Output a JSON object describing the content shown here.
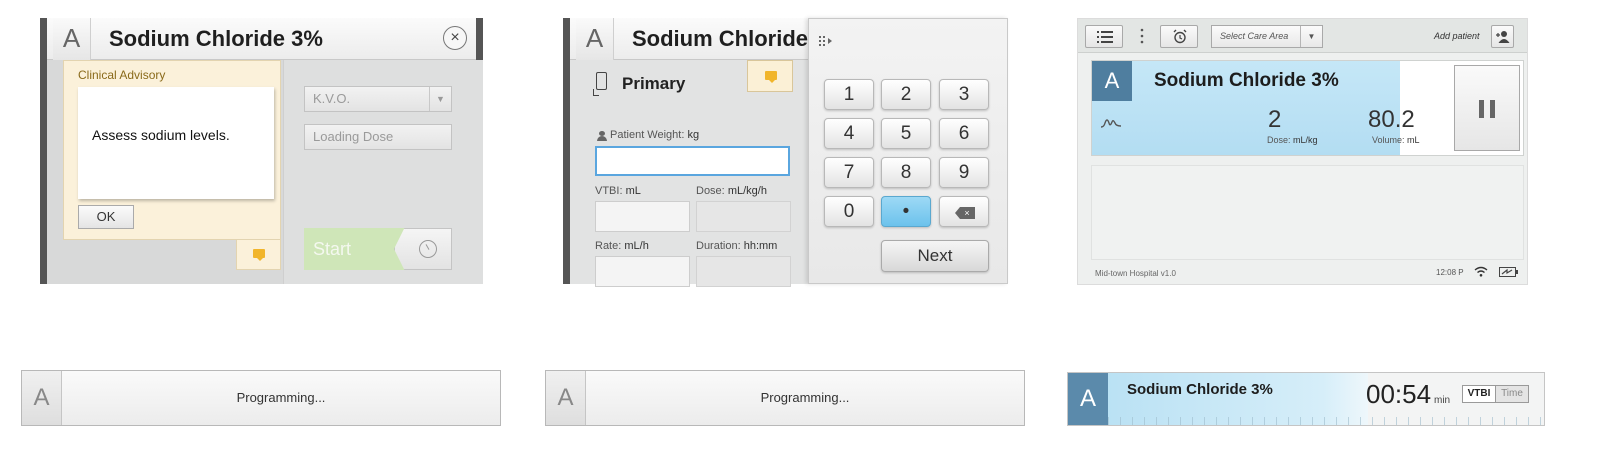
{
  "panel1": {
    "badge": "A",
    "title": "Sodium Chloride 3%",
    "close_glyph": "×",
    "advisory": {
      "title": "Clinical Advisory",
      "message": "Assess sodium levels.",
      "ok_label": "OK"
    },
    "mode_select": "K.V.O.",
    "loading_dose_label": "Loading Dose",
    "start_label": "Start",
    "icons": [
      "close-icon",
      "chat-icon",
      "chevron-down-icon",
      "clock-icon"
    ],
    "colors": {
      "advisory_bg": "#fbf1da",
      "start_bg": "#cfe6b8",
      "note_icon": "#f1b52b"
    }
  },
  "panel2": {
    "badge": "A",
    "title": "Sodium Chloride",
    "primary_label": "Primary",
    "fields": {
      "patient_weight": {
        "label": "Patient Weight:",
        "unit": "kg",
        "value": ""
      },
      "vtbi": {
        "label": "VTBI:",
        "unit": "mL",
        "value": ""
      },
      "dose": {
        "label": "Dose:",
        "unit": "mL/kg/h",
        "value": ""
      },
      "rate": {
        "label": "Rate:",
        "unit": "mL/h",
        "value": ""
      },
      "duration": {
        "label": "Duration:",
        "unit": "hh:mm",
        "value": ""
      }
    },
    "keypad": {
      "keys": [
        "1",
        "2",
        "3",
        "4",
        "5",
        "6",
        "7",
        "8",
        "9",
        "0",
        "•"
      ],
      "backspace": "×",
      "next_label": "Next"
    },
    "colors": {
      "active_field": "#5aa6df",
      "decimal_key": "#8fd3f3"
    }
  },
  "panel3": {
    "care_area_placeholder": "Select Care Area",
    "add_patient_label": "Add patient",
    "channel": {
      "badge": "A",
      "title": "Sodium Chloride 3%",
      "dose_value": "2",
      "dose_label": "Dose:",
      "dose_unit": "mL/kg",
      "volume_value": "80.2",
      "volume_label": "Volume:",
      "volume_unit": "mL"
    },
    "footer_text": "Mid-town Hospital v1.0",
    "time": "12:08 P",
    "icons": [
      "list-icon",
      "more-icon",
      "alarm-clock-icon",
      "add-patient-icon",
      "waveform-icon",
      "pause-icon",
      "wifi-icon",
      "battery-icon"
    ],
    "colors": {
      "channel_bg": "#c5e7f7",
      "badge_bg": "#4f7e9f"
    }
  },
  "bars": {
    "bar1": {
      "badge": "A",
      "status": "Programming..."
    },
    "bar2": {
      "badge": "A",
      "status": "Programming..."
    },
    "bar3": {
      "badge": "A",
      "title": "Sodium Chloride 3%",
      "time_value": "00:54",
      "time_unit": "min",
      "seg_vtbi": "VTBI",
      "seg_time": "Time"
    }
  }
}
